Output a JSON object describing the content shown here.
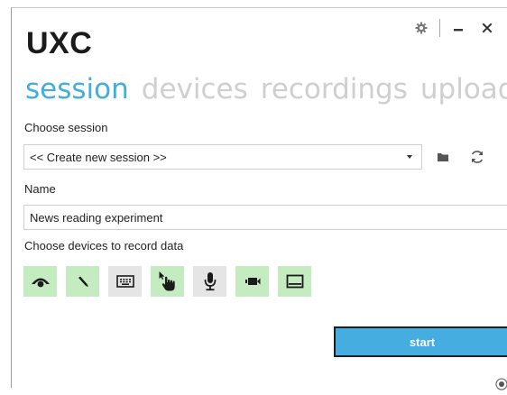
{
  "app": {
    "title": "UXC"
  },
  "nav": {
    "tabs": [
      {
        "label": "session",
        "active": true
      },
      {
        "label": "devices",
        "active": false
      },
      {
        "label": "recordings",
        "active": false
      },
      {
        "label": "upload",
        "active": false
      }
    ]
  },
  "session": {
    "choose_label": "Choose session",
    "selected": "<< Create new session >>",
    "name_label": "Name",
    "name_value": "News reading experiment",
    "devices_label": "Choose devices to record data"
  },
  "devices": [
    {
      "name": "eye-tracker",
      "icon": "eye-icon",
      "enabled": true
    },
    {
      "name": "pen",
      "icon": "pen-icon",
      "enabled": true
    },
    {
      "name": "keyboard",
      "icon": "keyboard-icon",
      "enabled": false
    },
    {
      "name": "mouse",
      "icon": "pointer-hand-icon",
      "enabled": true
    },
    {
      "name": "microphone",
      "icon": "microphone-icon",
      "enabled": false
    },
    {
      "name": "webcam",
      "icon": "camera-icon",
      "enabled": true
    },
    {
      "name": "screen",
      "icon": "screen-icon",
      "enabled": true
    }
  ],
  "actions": {
    "start_label": "start"
  },
  "colors": {
    "accent": "#42aee0",
    "inactive_tab": "#cfcfcf",
    "device_on": "#c5ecc0",
    "device_off": "#e5e5e5",
    "start_button": "#45ade0"
  }
}
